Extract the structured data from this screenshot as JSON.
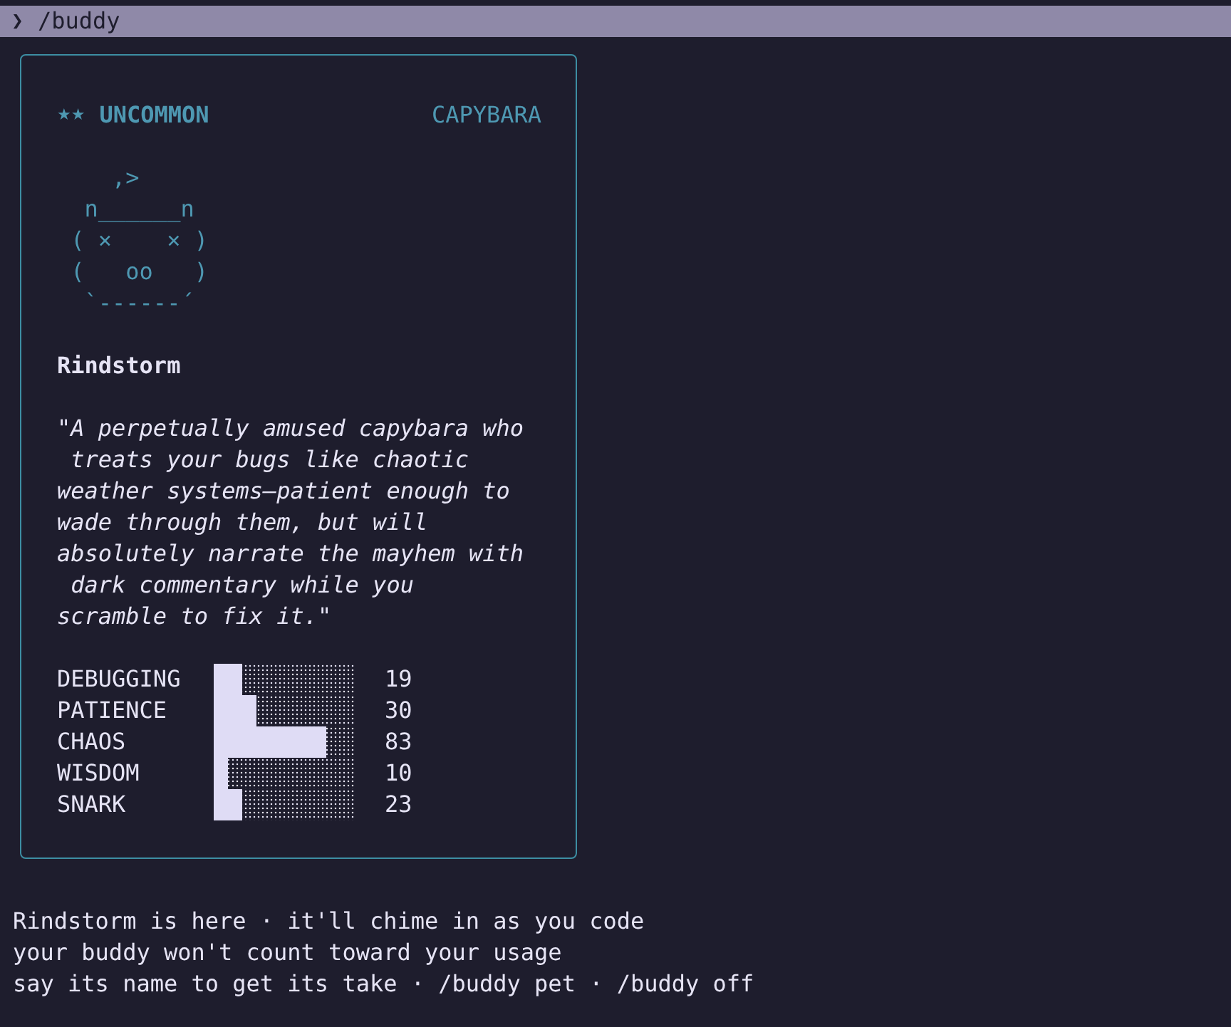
{
  "prompt": {
    "symbol": "❯",
    "command": "/buddy"
  },
  "card": {
    "rarity_stars": "★★",
    "rarity": "UNCOMMON",
    "species": "CAPYBARA",
    "art": [
      "    ,>",
      "  n______n",
      " ( ×    × )",
      " (   oo   )",
      "  `------´"
    ],
    "name": "Rindstorm",
    "quote": "\"A perpetually amused capybara who\n treats your bugs like chaotic\nweather systems—patient enough to\nwade through them, but will\nabsolutely narrate the mayhem with\n dark commentary while you\nscramble to fix it.\"",
    "stats": [
      {
        "label": "DEBUGGING",
        "level": 0.2,
        "value": "19"
      },
      {
        "label": "PATIENCE",
        "level": 0.3,
        "value": "30"
      },
      {
        "label": "CHAOS",
        "level": 0.8,
        "value": "83"
      },
      {
        "label": "WISDOM",
        "level": 0.1,
        "value": "10"
      },
      {
        "label": "SNARK",
        "level": 0.2,
        "value": "23"
      }
    ]
  },
  "messages": [
    "Rindstorm is here · it'll chime in as you code",
    "your buddy won't count toward your usage",
    "say its name to get its take · /buddy pet · /buddy off"
  ]
}
